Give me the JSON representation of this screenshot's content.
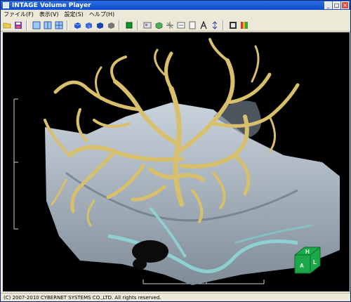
{
  "window": {
    "title": "INTAGE Volume Player"
  },
  "window_buttons": {
    "minimize": "_",
    "maximize": "□",
    "close": "×"
  },
  "menu": {
    "items": [
      {
        "label": "ファイル(F)"
      },
      {
        "label": "表示(V)"
      },
      {
        "label": "設定(S)"
      },
      {
        "label": "ヘルプ(H)"
      }
    ]
  },
  "toolbar": {
    "icons": [
      "open-folder-icon",
      "save-icon",
      "layout-single-icon",
      "layout-split-vertical-icon",
      "layout-quad-icon",
      "cube-blue-icon",
      "cube-blue-alt-icon",
      "cube-blue-shaded-icon",
      "cube-gray-icon",
      "stop-icon",
      "image-view-icon",
      "rotate-cube-icon",
      "crosshair-icon",
      "mpr-icon",
      "panel-icon",
      "text-tool-icon",
      "measure-icon",
      "film-icon",
      "color-bar-icon"
    ]
  },
  "orientation_cube": {
    "labels": {
      "top": "H",
      "left": "A",
      "right": "L"
    },
    "color": "#1aa84a"
  },
  "status": {
    "text": "(C) 2007-2010 CYBERNET SYSTEMS CO.,LTD. All rights reserved."
  },
  "colors": {
    "title_bar": "#0f4bc7",
    "window_face": "#ece9d8",
    "viewport_bg": "#000000",
    "vessel": "#d9c070",
    "bone": "#aab6c2",
    "cube": "#1aa84a"
  }
}
